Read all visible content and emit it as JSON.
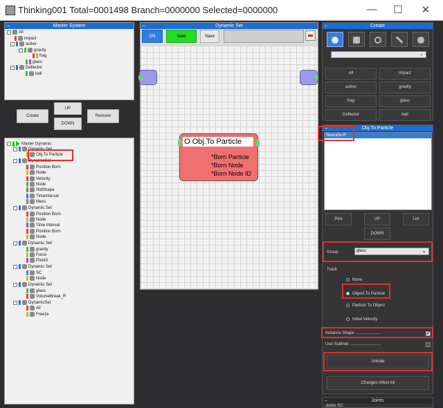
{
  "window": {
    "title": "Thinking001  Total=0001498  Branch=0000000  Selected=0000000",
    "minimize": "—",
    "maximize": "☐",
    "close": "✕"
  },
  "master_system": {
    "title": "Master System",
    "items": [
      "All",
      "impact",
      "active",
      "gravity",
      "frag",
      "glass",
      "Deflector",
      "ball"
    ]
  },
  "middle_buttons": {
    "create": "Create",
    "up": "UP",
    "down": "DOWN",
    "remove": "Remove"
  },
  "master_dynamic": {
    "title": "Master Dynamic",
    "items": [
      "Master Dynamic",
      "Dynamic Set",
      "Obj.To Particle",
      "DynamicSet",
      "Position Born",
      "Node",
      "Velocity",
      "Node",
      "StdShape",
      "TimeInterval",
      "Mass",
      "Dynamic Set",
      "Position Born",
      "Node",
      "Time Interval",
      "Position Born",
      "Node",
      "Dynamic Set",
      "gravity",
      "Force",
      "Point3",
      "Dynamic Set",
      "SC",
      "Node",
      "Dynamic Set",
      "glass",
      "VolumeBreak_R",
      "DynamicSet",
      "All",
      "Freeze"
    ]
  },
  "dynamic_set": {
    "title": "Dynamic Set",
    "on": "ON",
    "valid": "Valid",
    "save": "Save",
    "node_title": "O Obj.To Particle",
    "node_outputs": [
      "*Born Particle",
      "*Born Node",
      "*Born Node ID"
    ]
  },
  "create_panel": {
    "title": "Create",
    "groups": [
      "All",
      "impact",
      "active",
      "gravity",
      "frag",
      "glass",
      "Deflector",
      "ball"
    ]
  },
  "obj_panel": {
    "title": "Obj.To Particle",
    "list_item": "Skleničk-R",
    "pick": "Pick",
    "up": "UP",
    "list": "List",
    "down": "DOWN",
    "group_label": "Group",
    "group_value": "glass",
    "track_label": "Track",
    "track_options": [
      "None",
      "Object To Particle",
      "Particle To Object",
      "Initial Velocity"
    ],
    "instance_shape": "Instance Shape ......................",
    "use_subtree": "Use Subtree ...........................",
    "unhide": "Unhide",
    "changes_affect_all": "Changes Affect All"
  },
  "joints": {
    "title": "Joints",
    "sub": "Joints SC"
  },
  "colors": {
    "accent": "#1b6dd1",
    "node_fill": "#f07070",
    "valid_green": "#22dd22",
    "highlight": "#e03030"
  }
}
